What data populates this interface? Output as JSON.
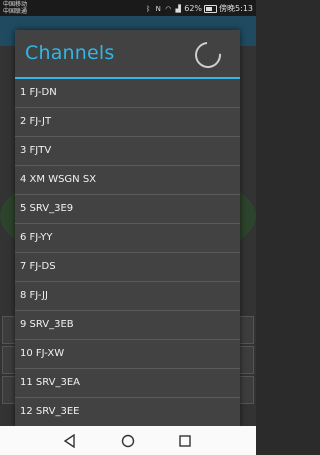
{
  "status_bar": {
    "carrier_1": "中国移动",
    "carrier_2": "中国联通",
    "battery": "62%",
    "clock": "傍晚5:13"
  },
  "dialog": {
    "title": "Channels",
    "channels": [
      "1 FJ-DN",
      "2 FJ-JT",
      "3 FJTV",
      "4 XM WSGN SX",
      "5 SRV_3E9",
      "6 FJ-YY",
      "7 FJ-DS",
      "8 FJ-JJ",
      "9 SRV_3EB",
      "10 FJ-XW",
      "11 SRV_3EA",
      "12 SRV_3EE"
    ]
  },
  "navigation": {
    "back": "back-icon",
    "home": "home-icon",
    "recents": "recents-icon"
  },
  "colors": {
    "accent": "#33b5e5",
    "dialog_bg": "#424242"
  }
}
